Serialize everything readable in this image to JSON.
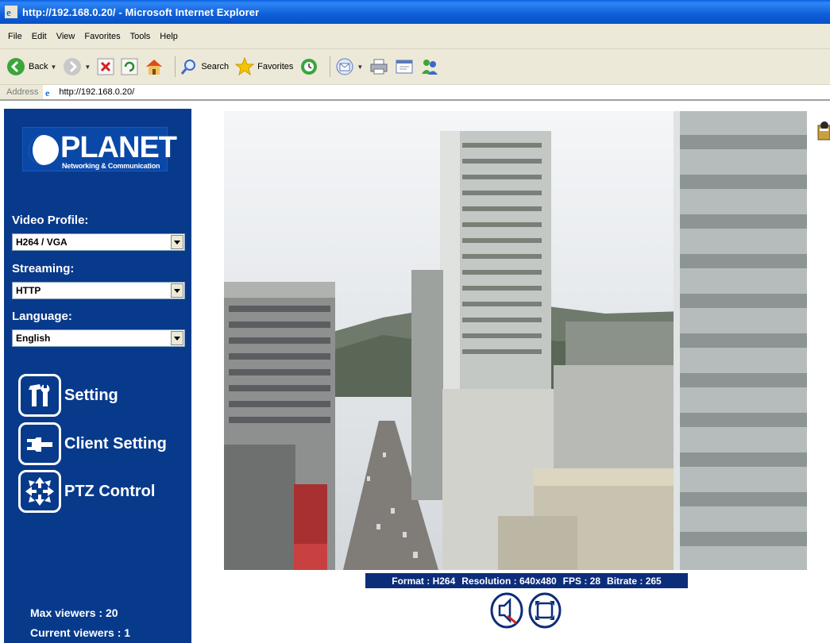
{
  "browser": {
    "title": "http://192.168.0.20/ - Microsoft Internet Explorer",
    "menu": [
      "File",
      "Edit",
      "View",
      "Favorites",
      "Tools",
      "Help"
    ],
    "toolbar": {
      "back": "Back",
      "search": "Search",
      "favorites": "Favorites"
    },
    "address_label": "Address",
    "address_value": "http://192.168.0.20/"
  },
  "sidebar": {
    "logo": {
      "brand": "PLANET",
      "tagline": "Networking & Communication"
    },
    "video_profile": {
      "label": "Video Profile:",
      "value": "H264 / VGA"
    },
    "streaming": {
      "label": "Streaming:",
      "value": "HTTP"
    },
    "language": {
      "label": "Language:",
      "value": "English"
    },
    "menu": [
      {
        "label": "Setting",
        "icon": "tools-icon"
      },
      {
        "label": "Client Setting",
        "icon": "wrench-icon"
      },
      {
        "label": "PTZ Control",
        "icon": "ptz-arrows-icon"
      }
    ],
    "max_viewers": "Max viewers : 20",
    "current_viewers": "Current viewers :  1"
  },
  "video": {
    "format": "Format : H264",
    "resolution": "Resolution : 640x480",
    "fps": "FPS : 28",
    "bitrate": "Bitrate : 265"
  },
  "colors": {
    "sidebar_bg": "#083a8c",
    "status_bg": "#0c2d7a",
    "titlebar": "#0a5fe0"
  }
}
